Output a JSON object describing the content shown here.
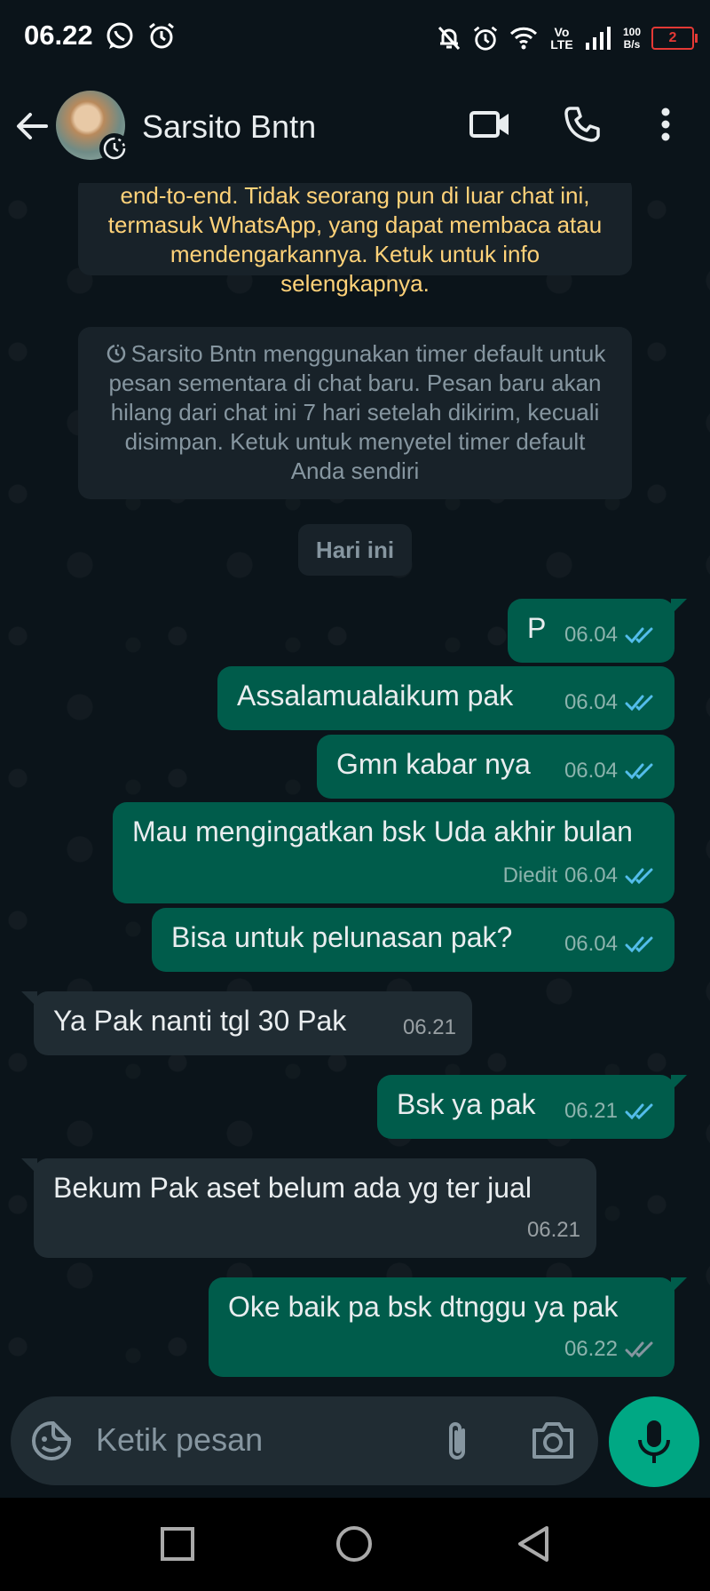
{
  "status_bar": {
    "time": "06.22",
    "network_label": "Vo LTE",
    "net_speed_value": "100",
    "net_speed_unit": "B/s",
    "battery_level": "2"
  },
  "header": {
    "contact_name": "Sarsito Bntn"
  },
  "system_messages": {
    "encryption_notice": "end-to-end. Tidak seorang pun di luar chat ini, termasuk WhatsApp, yang dapat membaca atau mendengarkannya. Ketuk untuk info selengkapnya.",
    "timer_notice": "Sarsito Bntn menggunakan timer default untuk pesan sementara di chat baru. Pesan baru akan hilang dari chat ini 7 hari setelah dikirim, kecuali disimpan. Ketuk untuk menyetel timer default Anda sendiri"
  },
  "date_divider": "Hari ini",
  "messages": [
    {
      "dir": "out",
      "text": "P",
      "time": "06.04",
      "status": "read"
    },
    {
      "dir": "out",
      "text": "Assalamualaikum pak",
      "time": "06.04",
      "status": "read"
    },
    {
      "dir": "out",
      "text": "Gmn kabar nya",
      "time": "06.04",
      "status": "read"
    },
    {
      "dir": "out",
      "text": "Mau mengingatkan bsk Uda akhir bulan",
      "time": "06.04",
      "edited": "Diedit",
      "status": "read"
    },
    {
      "dir": "out",
      "text": "Bisa untuk pelunasan pak?",
      "time": "06.04",
      "status": "read"
    },
    {
      "dir": "in",
      "text": "Ya Pak nanti tgl 30 Pak",
      "time": "06.21"
    },
    {
      "dir": "out",
      "text": "Bsk ya pak",
      "time": "06.21",
      "status": "read"
    },
    {
      "dir": "in",
      "text": "Bekum Pak aset belum ada yg ter jual",
      "time": "06.21"
    },
    {
      "dir": "out",
      "text": "Oke baik pa bsk dtnggu ya pak",
      "time": "06.22",
      "status": "delivered"
    }
  ],
  "composer": {
    "placeholder": "Ketik pesan"
  },
  "colors": {
    "read_tick": "#53bdeb",
    "delivered_tick": "#8696a0",
    "outgoing_bubble": "#005c4b",
    "incoming_bubble": "#202c33",
    "accent": "#00a884",
    "encryption_text": "#ffd279"
  }
}
